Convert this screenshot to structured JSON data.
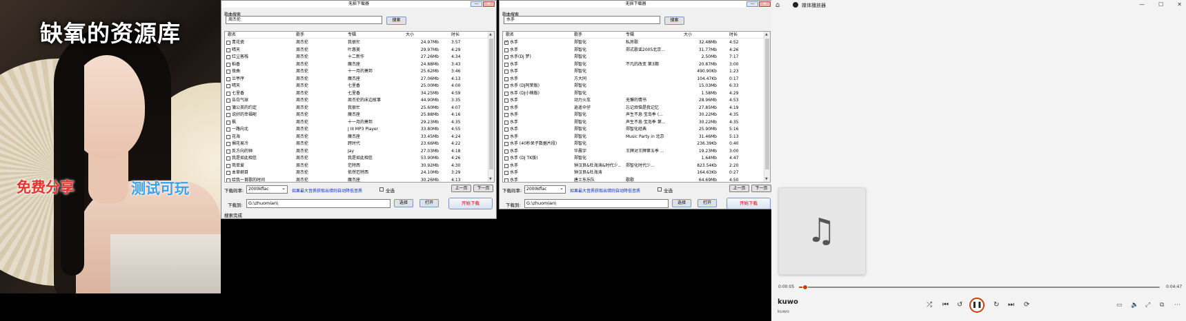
{
  "poster": {
    "title": "缺氧的资源库",
    "tag_left": "免费分享",
    "tag_right": "测试可玩"
  },
  "icons": {
    "minimize": "minimize-icon",
    "close": "close-icon",
    "checkbox": "checkbox-icon",
    "home": "home-icon",
    "music_note": "music-note-icon"
  },
  "win1": {
    "title": "无损下载器",
    "group_label": "歌曲搜索",
    "query": "周杰伦",
    "search_btn": "搜索",
    "columns": [
      "歌名",
      "歌手",
      "专辑",
      "大小",
      "时长"
    ],
    "rows": [
      {
        "c": false,
        "n": "青花瓷",
        "s": "周杰伦",
        "a": "我很忙",
        "z": "24.97Mb",
        "t": "3:57"
      },
      {
        "c": false,
        "n": "晴天",
        "s": "周杰伦",
        "a": "叶惠美",
        "z": "29.97Mb",
        "t": "4:29"
      },
      {
        "c": false,
        "n": "红尘客栈",
        "s": "周杰伦",
        "a": "十二新作",
        "z": "27.26Mb",
        "t": "4:34"
      },
      {
        "c": false,
        "n": "稻香",
        "s": "周杰伦",
        "a": "魔杰座",
        "z": "24.88Mb",
        "t": "3:43"
      },
      {
        "c": false,
        "n": "夜曲",
        "s": "周杰伦",
        "a": "十一月的萧邦",
        "z": "25.62Mb",
        "t": "3:46"
      },
      {
        "c": false,
        "n": "兰亭序",
        "s": "周杰伦",
        "a": "魔杰座",
        "z": "27.06Mb",
        "t": "4:13"
      },
      {
        "c": false,
        "n": "晴天",
        "s": "周杰伦",
        "a": "七里香",
        "z": "25.00Mb",
        "t": "4:00"
      },
      {
        "c": false,
        "n": "七里香",
        "s": "周杰伦",
        "a": "七里香",
        "z": "34.25Mb",
        "t": "4:59"
      },
      {
        "c": false,
        "n": "告白气球",
        "s": "周杰伦",
        "a": "周杰伦的床边故事",
        "z": "44.90Mb",
        "t": "3:35"
      },
      {
        "c": false,
        "n": "蒲公英的约定",
        "s": "周杰伦",
        "a": "我很忙",
        "z": "25.60Mb",
        "t": "4:07"
      },
      {
        "c": false,
        "n": "说好的幸福呢",
        "s": "周杰伦",
        "a": "魔杰座",
        "z": "25.88Mb",
        "t": "4:16"
      },
      {
        "c": false,
        "n": "枫",
        "s": "周杰伦",
        "a": "十一月的萧邦",
        "z": "29.23Mb",
        "t": "4:35"
      },
      {
        "c": false,
        "n": "一路向北",
        "s": "周杰伦",
        "a": "J III MP3 Player",
        "z": "33.80Mb",
        "t": "4:55"
      },
      {
        "c": false,
        "n": "花海",
        "s": "周杰伦",
        "a": "魔杰座",
        "z": "33.45Mb",
        "t": "4:24"
      },
      {
        "c": false,
        "n": "搁花易冷",
        "s": "周杰伦",
        "a": "跨时代",
        "z": "23.66Mb",
        "t": "4:22"
      },
      {
        "c": false,
        "n": "反方向的钟",
        "s": "周杰伦",
        "a": "Jay",
        "z": "27.03Mb",
        "t": "4:18"
      },
      {
        "c": false,
        "n": "我是如此相信",
        "s": "周杰伦",
        "a": "我是如此相信",
        "z": "53.90Mb",
        "t": "4:26"
      },
      {
        "c": false,
        "n": "简单爱",
        "s": "周杰伦",
        "a": "范特西",
        "z": "30.92Mb",
        "t": "4:30"
      },
      {
        "c": false,
        "n": "本草纲目",
        "s": "周杰伦",
        "a": "依然范特西",
        "z": "24.10Mb",
        "t": "3:29"
      },
      {
        "c": false,
        "n": "给我一首歌的时间",
        "s": "周杰伦",
        "a": "魔杰座",
        "z": "30.26Mb",
        "t": "4:13"
      }
    ],
    "rate_label": "下载码率:",
    "rate_value": "2000kflac",
    "tip": "如果最大音质获取出错则自动降低音质",
    "select_all": "全选",
    "prev": "上一页",
    "next": "下一页",
    "dl_label": "下载到:",
    "path": "G:\\zhuomian\\",
    "choose": "选择",
    "open": "打开",
    "start": "开始下载",
    "status": "搜索完成"
  },
  "win2": {
    "title": "无损下载器",
    "group_label": "歌曲搜索",
    "query": "水手",
    "search_btn": "搜索",
    "columns": [
      "歌名",
      "歌手",
      "专辑",
      "大小",
      "时长"
    ],
    "rows": [
      {
        "c": true,
        "n": "水手",
        "s": "郑智化",
        "a": "私房歌",
        "z": "32.48Mb",
        "t": "4:52"
      },
      {
        "c": false,
        "n": "水手",
        "s": "郑智化",
        "a": "郑式歌谣2005北京...",
        "z": "31.77Mb",
        "t": "4:26"
      },
      {
        "c": false,
        "n": "水手(Dj 梦)",
        "s": "郑智化",
        "a": "",
        "z": "2.50Mb",
        "t": "7:17"
      },
      {
        "c": false,
        "n": "水手",
        "s": "郑智化",
        "a": "不凡的改变 第3期",
        "z": "20.87Mb",
        "t": "3:00"
      },
      {
        "c": false,
        "n": "水手",
        "s": "郑智化",
        "a": "",
        "z": "490.90Kb",
        "t": "1:23"
      },
      {
        "c": false,
        "n": "水手",
        "s": "方大同",
        "a": "",
        "z": "104.47Kb",
        "t": "0:17"
      },
      {
        "c": false,
        "n": "水手 (DJ阿荣版)",
        "s": "郑智化",
        "a": "",
        "z": "15.03Mb",
        "t": "6:33"
      },
      {
        "c": false,
        "n": "水手 (DJ小楠版)",
        "s": "郑智化",
        "a": "",
        "z": "1.58Mb",
        "t": "4:29"
      },
      {
        "c": false,
        "n": "水手",
        "s": "动力火车",
        "a": "无懈的情书",
        "z": "28.96Mb",
        "t": "4:53"
      },
      {
        "c": false,
        "n": "水手",
        "s": "逍遥伞仔",
        "a": "忘记烦恼是我记忆",
        "z": "27.85Mb",
        "t": "4:19"
      },
      {
        "c": false,
        "n": "水手",
        "s": "郑智化",
        "a": "声生不息·宝岛季 (...",
        "z": "30.22Mb",
        "t": "4:35"
      },
      {
        "c": false,
        "n": "水手",
        "s": "郑智化",
        "a": "声生不息·宝岛季 第...",
        "z": "30.22Mb",
        "t": "4:35"
      },
      {
        "c": false,
        "n": "水手",
        "s": "郑智化",
        "a": "郑智化经典",
        "z": "25.90Mb",
        "t": "5:16"
      },
      {
        "c": false,
        "n": "水手",
        "s": "郑智化",
        "a": "Music Party in 北京",
        "z": "31.46Mb",
        "t": "5:13"
      },
      {
        "c": false,
        "n": "水手 (40秒呆子数据片段)",
        "s": "郑智化",
        "a": "",
        "z": "236.39Kb",
        "t": "0:40"
      },
      {
        "c": false,
        "n": "水手",
        "s": "华晨宇",
        "a": "王牌对王牌第五季 ...",
        "z": "19.23Mb",
        "t": "3:00"
      },
      {
        "c": false,
        "n": "水手 (DJ TK版)",
        "s": "郑智化",
        "a": "",
        "z": "1.64Mb",
        "t": "4:47"
      },
      {
        "c": false,
        "n": "水手",
        "s": "钟汉良&杜海涛&时代少...",
        "a": "郑智化时代少...",
        "z": "823.54Kb",
        "t": "2:20"
      },
      {
        "c": false,
        "n": "水手",
        "s": "钟汉良&杜海涛",
        "a": "",
        "z": "164.63Kb",
        "t": "0:27"
      },
      {
        "c": false,
        "n": "水手",
        "s": "唐士东乐队",
        "a": "歌歌",
        "z": "64.69Mb",
        "t": "4:50"
      }
    ],
    "rate_label": "下载码率:",
    "rate_value": "2000kflac",
    "tip": "如果最大音质获取出错则自动降低音质",
    "select_all": "全选",
    "prev": "上一页",
    "next": "下一页",
    "dl_label": "下载到:",
    "path": "G:\\zhuomian\\",
    "choose": "选择",
    "open": "打开",
    "start": "开始下载"
  },
  "player": {
    "title": "媒体播放器",
    "current": "0:00:05",
    "total": "0:04:47",
    "progress": 0.017,
    "song": "kuwo",
    "artist": "kuwo",
    "accent": "#c4410b"
  }
}
